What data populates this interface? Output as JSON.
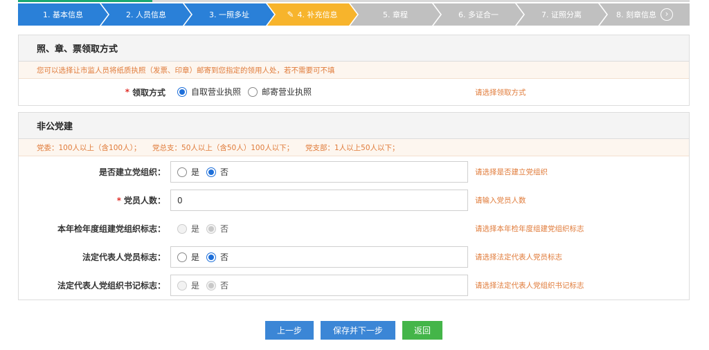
{
  "steps": [
    {
      "label": "1. 基本信息",
      "state": "done"
    },
    {
      "label": "2. 人员信息",
      "state": "done"
    },
    {
      "label": "3. 一照多址",
      "state": "done"
    },
    {
      "label": "4. 补充信息",
      "state": "active"
    },
    {
      "label": "5. 章程",
      "state": "todo"
    },
    {
      "label": "6. 多证合一",
      "state": "todo"
    },
    {
      "label": "7. 证照分离",
      "state": "todo"
    },
    {
      "label": "8. 刻章信息",
      "state": "todo"
    }
  ],
  "license_section": {
    "title": "照、章、票领取方式",
    "notice": "您可以选择让市监人员将纸质执照（发票、印章）邮寄到您指定的领用人处，若不需要可不填",
    "field_label": "领取方式",
    "options": [
      "自取营业执照",
      "邮寄营业执照"
    ],
    "selected": "自取营业执照",
    "hint": "请选择领取方式"
  },
  "party_section": {
    "title": "非公党建",
    "notice": "党委：100人以上（含100人）；     党总支：50人以上（含50人）100人以下；     党支部：1人以上50人以下；",
    "fields": [
      {
        "label": "是否建立党组织：",
        "required": false,
        "type": "radio",
        "options": [
          "是",
          "否"
        ],
        "selected": "否",
        "disabled": false,
        "hint": "请选择是否建立党组织"
      },
      {
        "label": "党员人数：",
        "required": true,
        "type": "text",
        "value": "0",
        "hint": "请输入党员人数"
      },
      {
        "label": "本年检年度组建党组织标志：",
        "required": false,
        "type": "radio",
        "options": [
          "是",
          "否"
        ],
        "selected": "否",
        "disabled": true,
        "hint": "请选择本年检年度组建党组织标志"
      },
      {
        "label": "法定代表人党员标志：",
        "required": false,
        "type": "radio",
        "options": [
          "是",
          "否"
        ],
        "selected": "否",
        "disabled": false,
        "hint": "请选择法定代表人党员标志"
      },
      {
        "label": "法定代表人党组织书记标志：",
        "required": false,
        "type": "radio",
        "options": [
          "是",
          "否"
        ],
        "selected": "否",
        "disabled": true,
        "hint": "请选择法定代表人党组织书记标志"
      }
    ]
  },
  "buttons": {
    "prev": "上一步",
    "save_next": "保存并下一步",
    "back": "返回"
  },
  "colors": {
    "done": "#2a80d8",
    "active": "#f7b42c",
    "todo": "#c0c0c0",
    "hint": "#e07b3a",
    "required": "#e0302a",
    "radio_on": "#1e6fd9",
    "button_blue": "#3b86d6",
    "button_green": "#44b549"
  }
}
